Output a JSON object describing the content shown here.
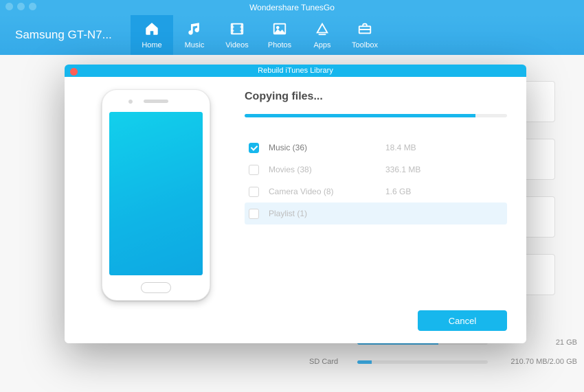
{
  "app_title": "Wondershare TunesGo",
  "device_name": "Samsung GT-N7...",
  "nav": [
    {
      "id": "home",
      "label": "Home",
      "active": true
    },
    {
      "id": "music",
      "label": "Music",
      "active": false
    },
    {
      "id": "videos",
      "label": "Videos",
      "active": false
    },
    {
      "id": "photos",
      "label": "Photos",
      "active": false
    },
    {
      "id": "apps",
      "label": "Apps",
      "active": false
    },
    {
      "id": "toolbox",
      "label": "Toolbox",
      "active": false
    }
  ],
  "storage": [
    {
      "label": "",
      "text": "21 GB",
      "pct": 62
    },
    {
      "label": "SD Card",
      "text": "210.70 MB/2.00 GB",
      "pct": 11
    }
  ],
  "modal": {
    "title": "Rebuild iTunes Library",
    "heading": "Copying files...",
    "progress_pct": 88,
    "items": [
      {
        "label": "Music (36)",
        "size": "18.4 MB",
        "checked": true,
        "highlight": false
      },
      {
        "label": "Movies (38)",
        "size": "336.1 MB",
        "checked": false,
        "highlight": false
      },
      {
        "label": "Camera Video (8)",
        "size": "1.6 GB",
        "checked": false,
        "highlight": false
      },
      {
        "label": "Playlist (1)",
        "size": "",
        "checked": false,
        "highlight": true
      }
    ],
    "cancel_label": "Cancel"
  }
}
